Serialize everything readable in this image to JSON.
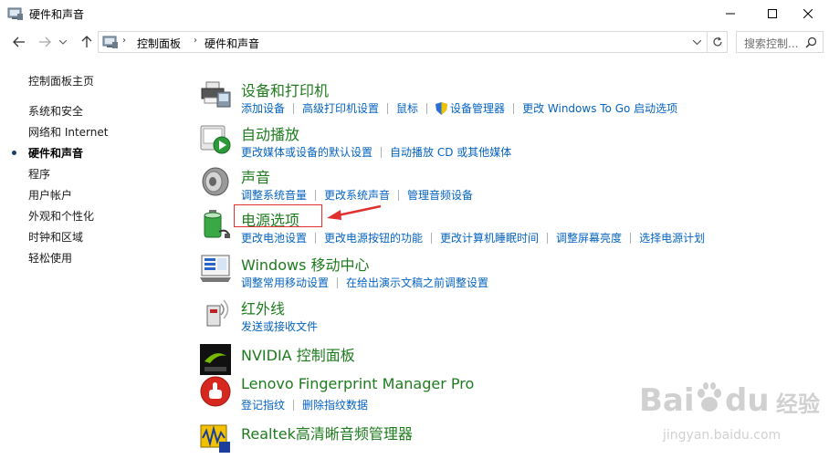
{
  "window": {
    "title": "硬件和声音"
  },
  "address": {
    "crumbs": [
      "控制面板",
      "硬件和声音"
    ],
    "search_placeholder": "搜索控制..."
  },
  "sidebar": {
    "items": [
      {
        "label": "控制面板主页"
      },
      {
        "label": "系统和安全"
      },
      {
        "label": "网络和 Internet"
      },
      {
        "label": "硬件和声音"
      },
      {
        "label": "程序"
      },
      {
        "label": "用户帐户"
      },
      {
        "label": "外观和个性化"
      },
      {
        "label": "时钟和区域"
      },
      {
        "label": "轻松使用"
      }
    ]
  },
  "categories": [
    {
      "title": "设备和打印机",
      "icon": "printer-icon",
      "links": [
        "添加设备",
        "高级打印机设置",
        "鼠标",
        "设备管理器",
        "更改 Windows To Go 启动选项"
      ]
    },
    {
      "title": "自动播放",
      "icon": "autoplay-icon",
      "links": [
        "更改媒体或设备的默认设置",
        "自动播放 CD 或其他媒体"
      ]
    },
    {
      "title": "声音",
      "icon": "speaker-icon",
      "links": [
        "调整系统音量",
        "更改系统声音",
        "管理音频设备"
      ]
    },
    {
      "title": "电源选项",
      "icon": "battery-icon",
      "links": [
        "更改电池设置",
        "更改电源按钮的功能",
        "更改计算机睡眠时间",
        "调整屏幕亮度",
        "选择电源计划"
      ]
    },
    {
      "title": "Windows 移动中心",
      "icon": "mobility-center-icon",
      "links": [
        "调整常用移动设置",
        "在给出演示文稿之前调整设置"
      ]
    },
    {
      "title": "红外线",
      "icon": "infrared-icon",
      "links": [
        "发送或接收文件"
      ]
    },
    {
      "title": "NVIDIA 控制面板",
      "icon": "nvidia-icon",
      "links": []
    },
    {
      "title": "Lenovo Fingerprint Manager Pro",
      "icon": "fingerprint-icon",
      "links": [
        "登记指纹",
        "删除指纹数据"
      ]
    },
    {
      "title": "Realtek高清晰音频管理器",
      "icon": "realtek-audio-icon",
      "links": []
    }
  ],
  "watermark": {
    "brand": "Bai",
    "paw": "du",
    "cn": "经验",
    "url": "jingyan.baidu.com"
  },
  "colors": {
    "category_title": "#1e7b1e",
    "link": "#0563c1",
    "highlight": "#e03030"
  }
}
